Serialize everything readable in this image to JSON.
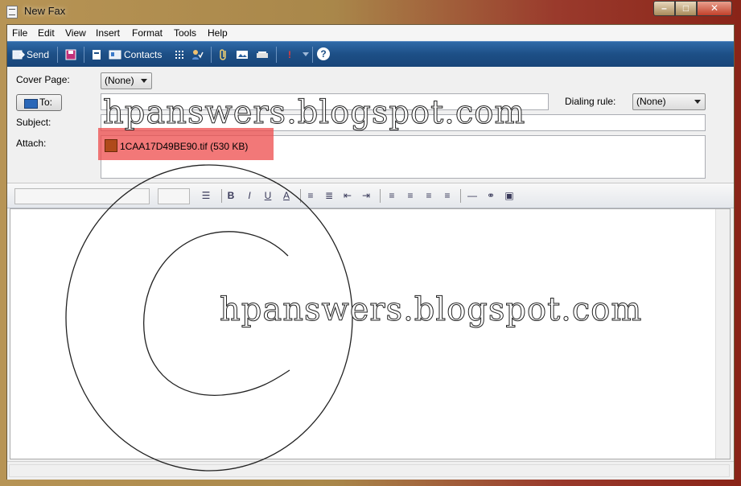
{
  "window": {
    "title": "New Fax",
    "minimize_glyph": "–",
    "maximize_glyph": "□",
    "close_glyph": "✕"
  },
  "menu": [
    "File",
    "Edit",
    "View",
    "Insert",
    "Format",
    "Tools",
    "Help"
  ],
  "toolbar": {
    "send_label": "Send",
    "contacts_label": "Contacts",
    "help_glyph": "?",
    "priority_glyph": "!"
  },
  "form": {
    "cover_page_label": "Cover Page:",
    "cover_page_value": "(None)",
    "to_button_label": "To:",
    "to_value": "",
    "dialing_rule_label": "Dialing rule:",
    "dialing_rule_value": "(None)",
    "subject_label": "Subject:",
    "subject_value": "",
    "attach_label": "Attach:",
    "attachment": "1CAA17D49BE90.tif (530 KB)"
  },
  "format_bar": {
    "font_name": "",
    "font_size": "",
    "bold": "B",
    "italic": "I",
    "underline": "U",
    "font_color": "A"
  },
  "watermark": {
    "text": "hpanswers.blogspot.com"
  },
  "colors": {
    "toolbar": "#1d4f86",
    "highlight": "#ee4b4b"
  }
}
